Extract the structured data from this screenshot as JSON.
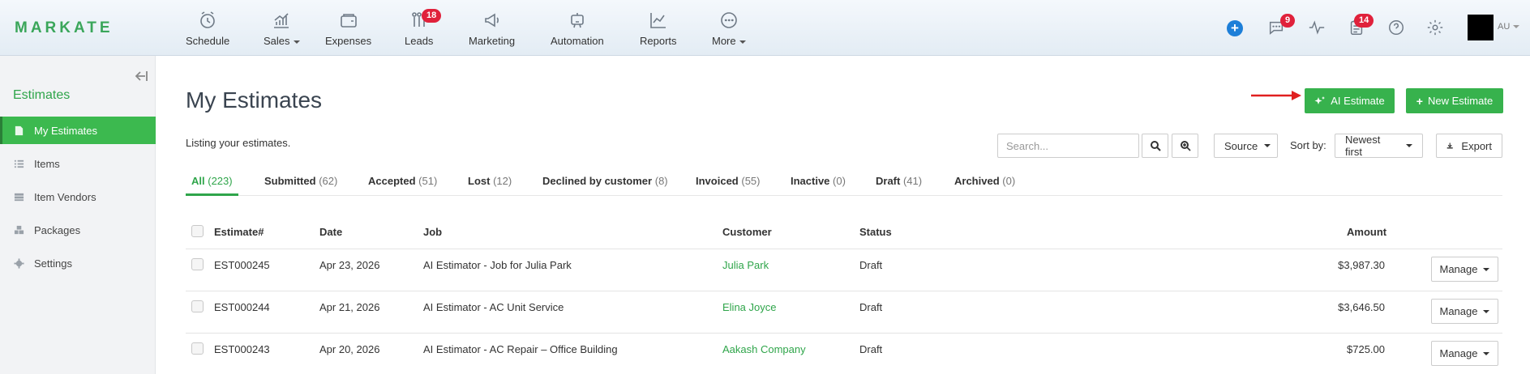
{
  "app": {
    "logo": "MARKATE",
    "user_initials": "AU"
  },
  "nav": [
    {
      "label": "Schedule",
      "icon": "clock-icon",
      "has_caret": false
    },
    {
      "label": "Sales",
      "icon": "sales-chart-icon",
      "has_caret": true
    },
    {
      "label": "Expenses",
      "icon": "wallet-icon",
      "has_caret": false
    },
    {
      "label": "Leads",
      "icon": "leads-icon",
      "has_caret": false,
      "badge": "18"
    },
    {
      "label": "Marketing",
      "icon": "megaphone-icon",
      "has_caret": false
    },
    {
      "label": "Automation",
      "icon": "robot-icon",
      "has_caret": false
    },
    {
      "label": "Reports",
      "icon": "line-chart-icon",
      "has_caret": false
    },
    {
      "label": "More",
      "icon": "more-dots-icon",
      "has_caret": true
    }
  ],
  "topright": {
    "messages_badge": "9",
    "tasks_badge": "14"
  },
  "sidebar": {
    "title": "Estimates",
    "items": [
      {
        "label": "My Estimates",
        "icon": "document-icon",
        "active": true
      },
      {
        "label": "Items",
        "icon": "list-icon",
        "active": false
      },
      {
        "label": "Item Vendors",
        "icon": "vendors-icon",
        "active": false
      },
      {
        "label": "Packages",
        "icon": "packages-icon",
        "active": false
      },
      {
        "label": "Settings",
        "icon": "gear-icon",
        "active": false
      }
    ]
  },
  "main": {
    "title": "My Estimates",
    "subtitle": "Listing your estimates.",
    "ai_estimate_label": "AI Estimate",
    "new_estimate_label": "New Estimate",
    "search_placeholder": "Search...",
    "source_label": "Source",
    "sort_by_label": "Sort by:",
    "sort_value": "Newest first",
    "export_label": "Export"
  },
  "tabs": [
    {
      "label": "All",
      "count": "(223)",
      "active": true
    },
    {
      "label": "Submitted",
      "count": "(62)"
    },
    {
      "label": "Accepted",
      "count": "(51)"
    },
    {
      "label": "Lost",
      "count": "(12)"
    },
    {
      "label": "Declined by customer",
      "count": "(8)"
    },
    {
      "label": "Invoiced",
      "count": "(55)"
    },
    {
      "label": "Inactive",
      "count": "(0)"
    },
    {
      "label": "Draft",
      "count": "(41)"
    },
    {
      "label": "Archived",
      "count": "(0)"
    }
  ],
  "table": {
    "headers": [
      "Estimate#",
      "Date",
      "Job",
      "Customer",
      "Status",
      "Amount"
    ],
    "manage_label": "Manage",
    "rows": [
      {
        "estimate": "EST000245",
        "date": "Apr 23, 2026",
        "job": "AI Estimator - Job for Julia Park",
        "customer": "Julia Park",
        "status": "Draft",
        "amount": "$3,987.30"
      },
      {
        "estimate": "EST000244",
        "date": "Apr 21, 2026",
        "job": "AI Estimator - AC Unit Service",
        "customer": "Elina Joyce",
        "status": "Draft",
        "amount": "$3,646.50"
      },
      {
        "estimate": "EST000243",
        "date": "Apr 20, 2026",
        "job": "AI Estimator - AC Repair – Office Building",
        "customer": "Aakash Company",
        "status": "Draft",
        "amount": "$725.00"
      }
    ]
  },
  "colors": {
    "brand_green": "#37b24d",
    "badge_red": "#e0213b",
    "plus_blue": "#1d7fd8"
  }
}
